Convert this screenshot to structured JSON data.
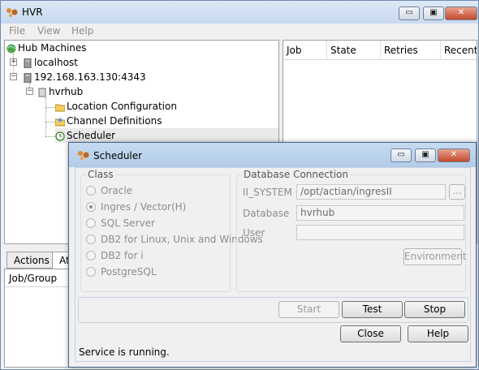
{
  "app": {
    "title": "HVR"
  },
  "menu": {
    "file": "File",
    "view": "View",
    "help": "Help"
  },
  "window_controls": {
    "minimize": "▭",
    "maximize": "▣",
    "close": "✕"
  },
  "tree": {
    "root": "Hub Machines",
    "localhost": "localhost",
    "remote": "192.168.163.130:4343",
    "hub": "hvrhub",
    "location_config": "Location Configuration",
    "channel_defs": "Channel Definitions",
    "scheduler": "Scheduler"
  },
  "job_table": {
    "columns": [
      "Job",
      "State",
      "Retries",
      "Recent"
    ]
  },
  "tabs": {
    "actions": "Actions",
    "second": "At"
  },
  "bottom_table": {
    "header": "Job/Group"
  },
  "dialog": {
    "title": "Scheduler",
    "class_group": "Class",
    "classes": [
      "Oracle",
      "Ingres / Vector(H)",
      "SQL Server",
      "DB2 for Linux, Unix and Windows",
      "DB2 for i",
      "PostgreSQL"
    ],
    "selected_class": "Ingres / Vector(H)",
    "db_group": "Database Connection",
    "fields": {
      "ii_system_label": "II_SYSTEM",
      "ii_system_value": "/opt/actian/ingresII",
      "database_label": "Database",
      "database_value": "hvrhub",
      "user_label": "User",
      "user_value": ""
    },
    "browse_label": "...",
    "environment_label": "Environment",
    "start_label": "Start",
    "test_label": "Test",
    "stop_label": "Stop",
    "close_label": "Close",
    "help_label": "Help",
    "status": "Service is running."
  }
}
